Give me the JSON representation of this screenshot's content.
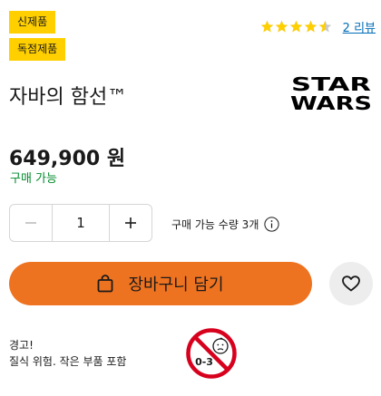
{
  "badges": {
    "new": "신제품",
    "exclusive": "독점제품"
  },
  "rating": {
    "stars": 4.5,
    "max": 5,
    "reviews_link": "2 리뷰",
    "star_color": "#ffcf00"
  },
  "product": {
    "title": "자바의 함선™",
    "brand_logo_lines": [
      "STAR",
      "WARS"
    ]
  },
  "price": {
    "value": "649,900 원",
    "availability": "구매 가능",
    "availability_color": "#008a2b"
  },
  "quantity": {
    "value": "1",
    "limit_text": "구매 가능 수량 3개"
  },
  "actions": {
    "add_to_cart": "장바구니 담기",
    "cart_color": "#ee7320"
  },
  "warning": {
    "title": "경고!",
    "text": "질식 위험. 작은 부품 포함",
    "age_label": "0-3"
  }
}
